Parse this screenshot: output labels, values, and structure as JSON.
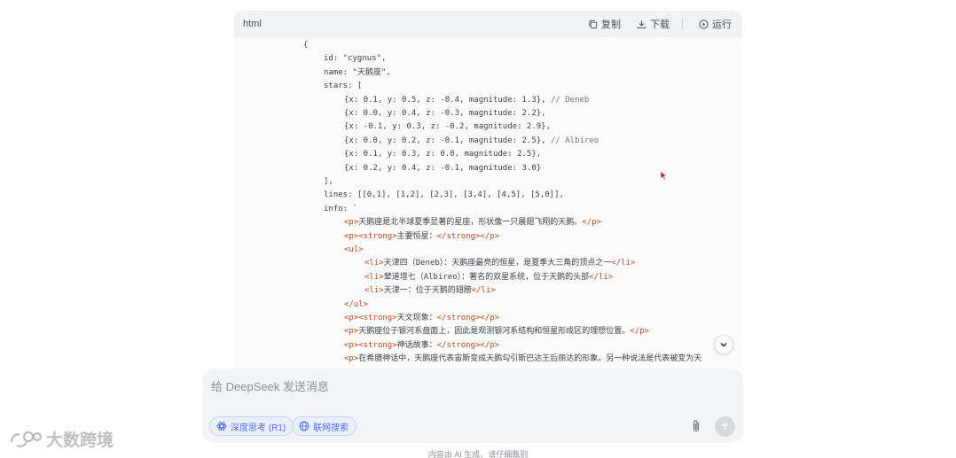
{
  "code_block": {
    "language": "html",
    "copy_label": "复制",
    "download_label": "下载",
    "run_label": "运行",
    "lines": [
      {
        "indent": 0,
        "text": "{"
      },
      {
        "indent": 1,
        "text": "id: \"cygnus\","
      },
      {
        "indent": 1,
        "text": "name: \"天鹅座\","
      },
      {
        "indent": 1,
        "text": "stars: ["
      },
      {
        "indent": 2,
        "text": "{x: 0.1, y: 0.5, z: -0.4, magnitude: 1.3}, // Deneb"
      },
      {
        "indent": 2,
        "text": "{x: 0.0, y: 0.4, z: -0.3, magnitude: 2.2},"
      },
      {
        "indent": 2,
        "text": "{x: -0.1, y: 0.3, z: -0.2, magnitude: 2.9},"
      },
      {
        "indent": 2,
        "text": "{x: 0.0, y: 0.2, z: -0.1, magnitude: 2.5}, // Albireo"
      },
      {
        "indent": 2,
        "text": "{x: 0.1, y: 0.3, z: 0.0, magnitude: 2.5},"
      },
      {
        "indent": 2,
        "text": "{x: 0.2, y: 0.4, z: -0.1, magnitude: 3.0}"
      },
      {
        "indent": 1,
        "text": "],"
      },
      {
        "indent": 1,
        "text": "lines: [[0,1], [1,2], [2,3], [3,4], [4,5], [5,0]],"
      },
      {
        "indent": 1,
        "text": "info: `"
      },
      {
        "indent": 2,
        "text": "<p>天鹅座是北半球夏季显著的星座，形状像一只展翅飞翔的天鹅。</p>"
      },
      {
        "indent": 2,
        "text": "<p><strong>主要恒星：</strong></p>"
      },
      {
        "indent": 2,
        "text": "<ul>"
      },
      {
        "indent": 3,
        "text": "<li>天津四（Deneb）：天鹅座最亮的恒星，是夏季大三角的顶点之一</li>"
      },
      {
        "indent": 3,
        "text": "<li>辇道增七（Albireo）：著名的双星系统，位于天鹅的头部</li>"
      },
      {
        "indent": 3,
        "text": "<li>天津一：位于天鹅的翅膀</li>"
      },
      {
        "indent": 2,
        "text": "</ul>"
      },
      {
        "indent": 2,
        "text": "<p><strong>天文现象：</strong></p>"
      },
      {
        "indent": 2,
        "text": "<p>天鹅座位于银河系盘面上，因此是观测银河系结构和恒星形成区的理想位置。</p>"
      },
      {
        "indent": 2,
        "text": "<p><strong>神话故事：</strong></p>"
      },
      {
        "indent": 2,
        "text": "<p>在希腊神话中，天鹅座代表宙斯变成天鹅勾引斯巴达王后丽达的形象。另一种说法是代表被变为天"
      }
    ]
  },
  "composer": {
    "placeholder": "给 DeepSeek 发送消息",
    "deep_think_label": "深度思考 (R1)",
    "web_search_label": "联网搜索"
  },
  "disclaimer": "内容由 AI 生成，请仔细甄别",
  "watermark": "大数跨境",
  "colors": {
    "accent": "#4d6bfe",
    "tag": "#b84a1e",
    "code_bg": "#fbfbfc",
    "composer_bg": "#f3f4f6"
  }
}
